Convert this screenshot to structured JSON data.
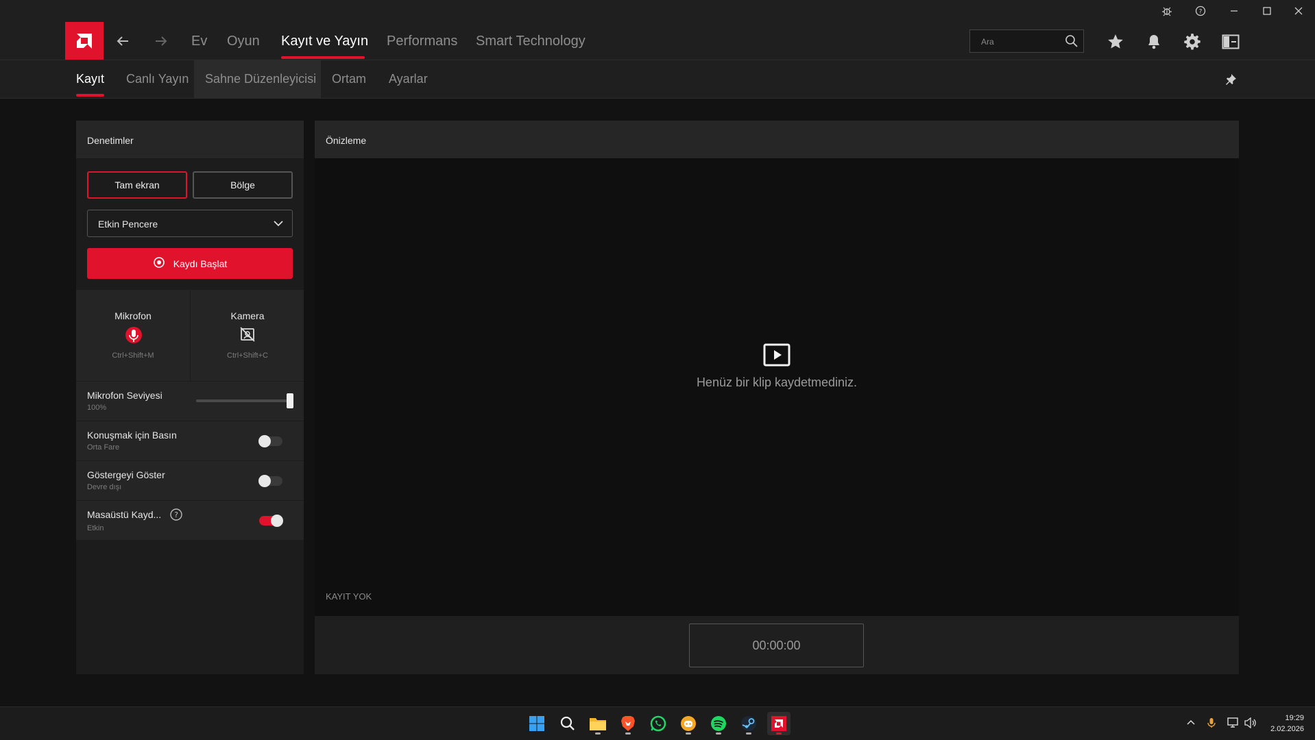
{
  "titlebar": {
    "icons": [
      "bug-icon",
      "help-icon",
      "minimize-icon",
      "maximize-icon",
      "close-icon"
    ]
  },
  "nav": {
    "tabs": [
      {
        "label": "Ev"
      },
      {
        "label": "Oyun"
      },
      {
        "label": "Kayıt ve Yayın",
        "active": true
      },
      {
        "label": "Performans"
      },
      {
        "label": "Smart Technology"
      }
    ],
    "search_placeholder": "Ara"
  },
  "subnav": {
    "tabs": [
      {
        "label": "Kayıt",
        "active": true
      },
      {
        "label": "Canlı Yayın"
      },
      {
        "label": "Sahne Düzenleyicisi"
      },
      {
        "label": "Ortam"
      },
      {
        "label": "Ayarlar"
      }
    ]
  },
  "controls": {
    "title": "Denetimler",
    "fullscreen_label": "Tam ekran",
    "region_label": "Bölge",
    "window_dropdown": "Etkin Pencere",
    "record_label": "Kaydı Başlat",
    "mic": {
      "label": "Mikrofon",
      "shortcut": "Ctrl+Shift+M"
    },
    "camera": {
      "label": "Kamera",
      "shortcut": "Ctrl+Shift+C"
    },
    "mic_level": {
      "label": "Mikrofon Seviyesi",
      "value_text": "100%",
      "value": 1.0
    },
    "push_to_talk": {
      "label": "Konuşmak için Basın",
      "sub": "Orta Fare",
      "on": false
    },
    "show_indicator": {
      "label": "Göstergeyi Göster",
      "sub": "Devre dışı",
      "on": false
    },
    "desktop_record": {
      "label": "Masaüstü Kayd...",
      "sub": "Etkin",
      "on": true
    }
  },
  "preview": {
    "title": "Önizleme",
    "empty_text": "Henüz bir klip kaydetmediniz.",
    "status": "KAYIT YOK",
    "timer": "00:00:00"
  },
  "taskbar": {
    "apps": [
      "windows-start-icon",
      "search-icon",
      "file-explorer-icon",
      "brave-icon",
      "whatsapp-icon",
      "discord-icon",
      "spotify-icon",
      "steam-icon",
      "amd-icon"
    ],
    "time": "19:29",
    "date": "2.02.2026"
  },
  "colors": {
    "accent": "#e0122c",
    "background": "#121212",
    "panel": "#1c1c1c"
  }
}
